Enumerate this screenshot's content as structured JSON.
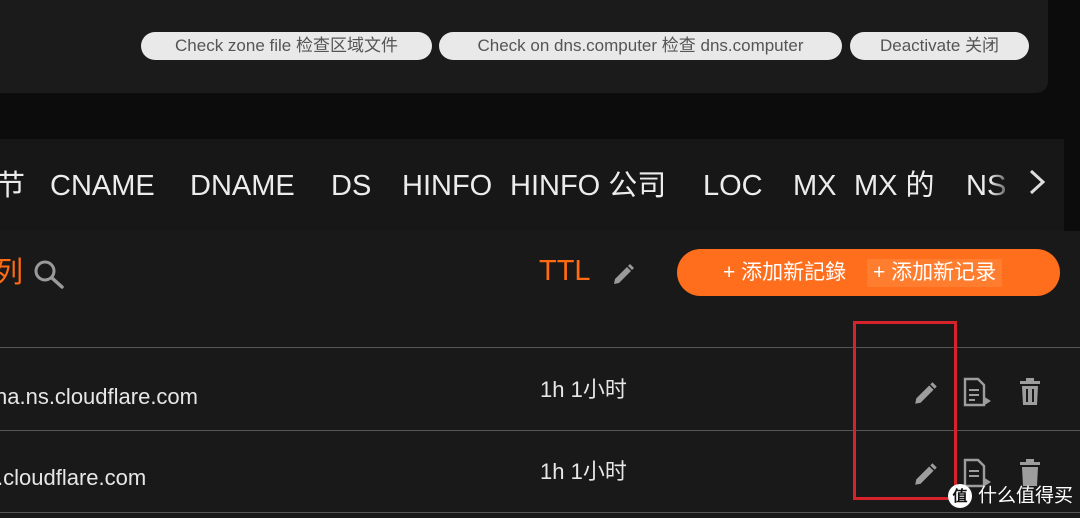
{
  "zone_actions": {
    "check_zone_file": "Check zone file  检查区域文件",
    "check_dns_computer": "Check on dns.computer  检查 dns.computer",
    "deactivate": "Deactivate  关闭"
  },
  "record_types": [
    "节",
    "CNAME",
    "DNAME",
    "DS",
    "HINFO",
    "HINFO 公司",
    "LOC",
    "MX",
    "MX 的",
    "NS"
  ],
  "table": {
    "header_partial": "列",
    "ttl_label": "TTL",
    "add_button_primary": "+ 添加新記錄",
    "add_button_secondary": "+ 添加新记录",
    "rows": [
      {
        "value": "ha.ns.cloudflare.com",
        "ttl": "1h  1小时"
      },
      {
        ".cloudflare.com": "",
        "value": ".cloudflare.com",
        "ttl": "1h  1小时"
      }
    ]
  },
  "watermark": {
    "badge": "值",
    "text": "什么值得买"
  },
  "colors": {
    "accent_orange": "#ff6e1c",
    "highlight_red": "#d6222a",
    "pill_bg": "#e9e9e9"
  }
}
